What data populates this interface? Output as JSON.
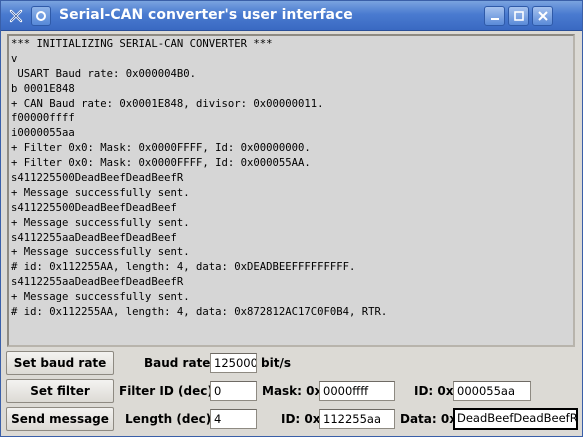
{
  "window": {
    "title": "Serial-CAN converter's user interface",
    "app_icon": "x-close-icon",
    "menu_icon": "window-menu-icon"
  },
  "console": {
    "lines": [
      "*** INITIALIZING SERIAL-CAN CONVERTER ***",
      "v",
      " USART Baud rate: 0x000004B0.",
      "b 0001E848",
      "+ CAN Baud rate: 0x0001E848, divisor: 0x00000011.",
      "f00000ffff",
      "i0000055aa",
      "+ Filter 0x0: Mask: 0x0000FFFF, Id: 0x00000000.",
      "+ Filter 0x0: Mask: 0x0000FFFF, Id: 0x000055AA.",
      "s411225500DeadBeefDeadBeefR",
      "+ Message successfully sent.",
      "s411225500DeadBeefDeadBeef",
      "+ Message successfully sent.",
      "s4112255aaDeadBeefDeadBeef",
      "+ Message successfully sent.",
      "# id: 0x112255AA, length: 4, data: 0xDEADBEEFFFFFFFFF.",
      "s4112255aaDeadBeefDeadBeefR",
      "+ Message successfully sent.",
      "# id: 0x112255AA, length: 4, data: 0x872812AC17C0F0B4, RTR."
    ]
  },
  "controls": {
    "baud": {
      "button": "Set baud rate",
      "label": "Baud rate:",
      "value": "125000",
      "unit": "bit/s"
    },
    "filter": {
      "button": "Set filter",
      "id_label": "Filter ID (dec):",
      "id_value": "0",
      "mask_label": "Mask: 0x",
      "mask_value": "0000ffff",
      "filter_id_label": "ID: 0x",
      "filter_id_value": "000055aa"
    },
    "message": {
      "button": "Send message",
      "length_label": "Length (dec):",
      "length_value": "4",
      "id_label": "ID: 0x",
      "id_value": "112255aa",
      "data_label": "Data: 0x",
      "data_value": "DeadBeefDeadBeefR"
    }
  }
}
